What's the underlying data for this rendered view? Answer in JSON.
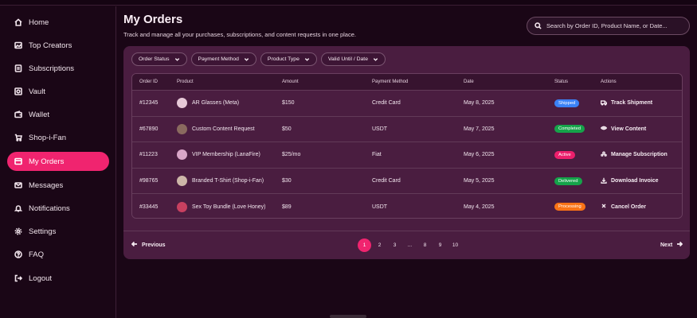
{
  "sidebar": {
    "items": [
      {
        "label": "Home",
        "icon": "home-icon"
      },
      {
        "label": "Top Creators",
        "icon": "image-icon"
      },
      {
        "label": "Subscriptions",
        "icon": "subscriptions-icon"
      },
      {
        "label": "Vault",
        "icon": "vault-icon"
      },
      {
        "label": "Wallet",
        "icon": "wallet-icon"
      },
      {
        "label": "Shop-i-Fan",
        "icon": "cart-icon"
      },
      {
        "label": "My Orders",
        "icon": "orders-icon",
        "active": true
      },
      {
        "label": "Messages",
        "icon": "message-icon"
      },
      {
        "label": "Notifications",
        "icon": "bell-icon"
      },
      {
        "label": "Settings",
        "icon": "gear-icon"
      },
      {
        "label": "FAQ",
        "icon": "question-icon"
      },
      {
        "label": "Logout",
        "icon": "logout-icon"
      }
    ]
  },
  "header": {
    "title": "My Orders",
    "subtitle": "Track and manage all your purchases, subscriptions, and content requests in one place."
  },
  "search": {
    "placeholder": "Search by Order ID, Product Name, or Date..."
  },
  "filters": [
    "Order Status",
    "Payment Method",
    "Product Type",
    "Valid Until / Date"
  ],
  "table": {
    "columns": [
      "Order ID",
      "Product",
      "Amount",
      "Payment Method",
      "Date",
      "Status",
      "Actions"
    ],
    "rows": [
      {
        "id": "#12345",
        "product": "AR Glasses (Meta)",
        "amount": "$150",
        "payment": "Credit Card",
        "date": "May 8, 2025",
        "status": "Shipped",
        "action": "Track Shipment",
        "action_icon": "truck-icon"
      },
      {
        "id": "#67890",
        "product": "Custom Content Request",
        "amount": "$50",
        "payment": "USDT",
        "date": "May 7, 2025",
        "status": "Completed",
        "action": "View Content",
        "action_icon": "eye-icon"
      },
      {
        "id": "#11223",
        "product": "VIP Membership (LanaFire)",
        "amount": "$25/mo",
        "payment": "Fiat",
        "date": "May 6, 2025",
        "status": "Active",
        "action": "Manage Subscription",
        "action_icon": "users-icon"
      },
      {
        "id": "#98765",
        "product": "Branded T-Shirt (Shop-i-Fan)",
        "amount": "$30",
        "payment": "Credit Card",
        "date": "May 5, 2025",
        "status": "Delivered",
        "action": "Download Invoice",
        "action_icon": "download-icon"
      },
      {
        "id": "#33445",
        "product": "Sex Toy Bundle (Love Honey)",
        "amount": "$89",
        "payment": "USDT",
        "date": "May 4, 2025",
        "status": "Processing",
        "action": "Cancel Order",
        "action_icon": "close-icon"
      }
    ]
  },
  "status_colors": {
    "Shipped": "#3b82f6",
    "Completed": "#16a34a",
    "Active": "#ec1f6c",
    "Delivered": "#15a34a",
    "Processing": "#f97316"
  },
  "pagination": {
    "prev": "Previous",
    "next": "Next",
    "pages": [
      "1",
      "2",
      "3",
      "...",
      "8",
      "9",
      "10"
    ],
    "current": "1"
  },
  "colors": {
    "accent": "#f0246f",
    "background": "#1a0616",
    "card": "#4a1d40"
  }
}
